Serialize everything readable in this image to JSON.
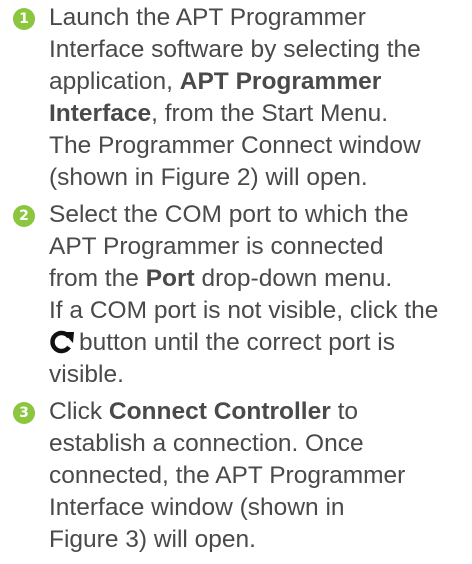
{
  "steps": [
    {
      "number": "1",
      "lines": {
        "l1": "Launch the APT Programmer",
        "l2": "Interface software by selecting the",
        "l3a": "application, ",
        "l3b": "APT Programmer",
        "l4a": "Interface",
        "l4b": ", from the Start Menu.",
        "l5": "The Programmer Connect window",
        "l6": "(shown in Figure 2) will open."
      }
    },
    {
      "number": "2",
      "lines": {
        "l1": "Select the COM port to which the",
        "l2": "APT Programmer is connected",
        "l3a": "from the ",
        "l3b": "Port",
        "l3c": " drop-down menu.",
        "l4": "If a COM port is not visible, click the",
        "l5": "button until the correct port is",
        "l6": "visible."
      },
      "icon": "refresh-icon"
    },
    {
      "number": "3",
      "lines": {
        "l1a": "Click ",
        "l1b": "Connect Controller",
        "l1c": " to",
        "l2": "establish a connection. Once",
        "l3": "connected, the APT Programmer",
        "l4": "Interface window (shown in",
        "l5": "Figure 3) will open."
      }
    }
  ],
  "colors": {
    "badge": "#8cc63f",
    "text": "#4a4a4a"
  }
}
